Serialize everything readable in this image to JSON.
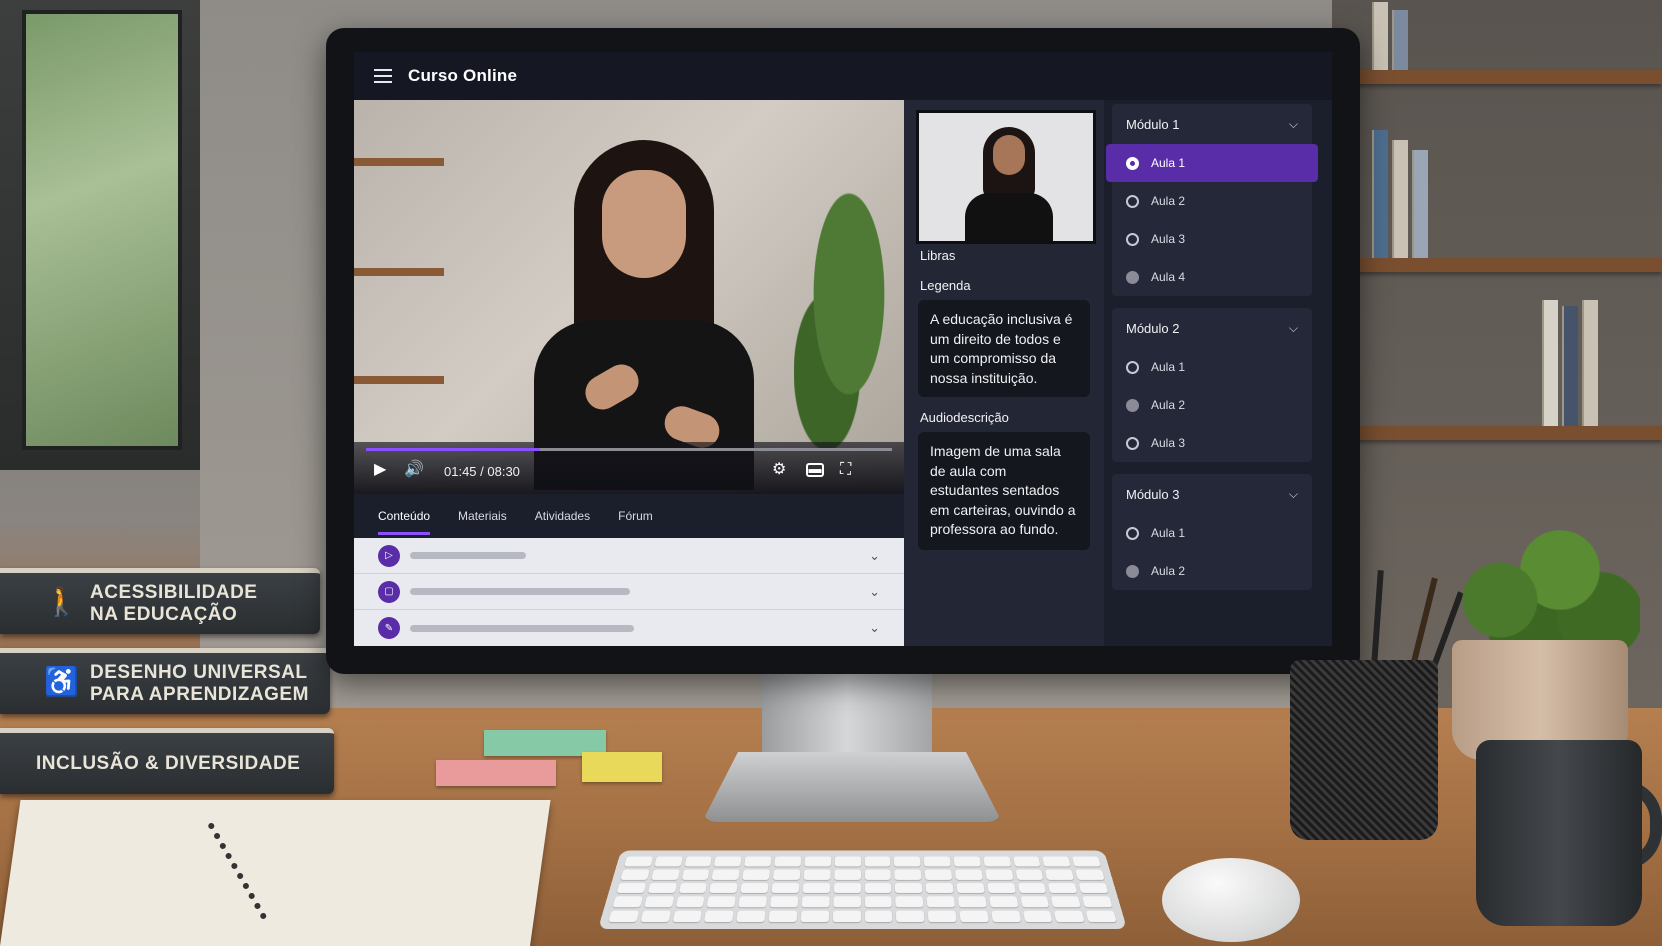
{
  "app": {
    "title": "Curso Online"
  },
  "player": {
    "time": "01:45 / 08:30",
    "progress": 0.33,
    "icons": [
      "play-icon",
      "volume-icon",
      "settings-icon",
      "captions-icon",
      "fullscreen-icon"
    ]
  },
  "tabs": [
    {
      "label": "Conteúdo",
      "active": true
    },
    {
      "label": "Materiais",
      "active": false
    },
    {
      "label": "Atividades",
      "active": false
    },
    {
      "label": "Fórum",
      "active": false
    }
  ],
  "content_rows": [
    {
      "icon": "video-icon"
    },
    {
      "icon": "document-icon"
    },
    {
      "icon": "activity-icon"
    }
  ],
  "accessibility": {
    "libras_label": "Libras",
    "legenda_label": "Legenda",
    "legenda_text": "A educação inclusiva é um direito de todos e um compromisso da nossa instituição.",
    "audiodesc_label": "Audiodescrição",
    "audiodesc_text": "Imagem de uma sala de aula com estudantes sentados em carteiras, ouvindo a professora ao fundo."
  },
  "modules": [
    {
      "title": "Módulo 1",
      "lessons": [
        {
          "label": "Aula 1",
          "state": "selected"
        },
        {
          "label": "Aula 2",
          "state": "empty"
        },
        {
          "label": "Aula 3",
          "state": "empty"
        },
        {
          "label": "Aula 4",
          "state": "filled"
        }
      ]
    },
    {
      "title": "Módulo 2",
      "lessons": [
        {
          "label": "Aula 1",
          "state": "empty"
        },
        {
          "label": "Aula 2",
          "state": "filled"
        },
        {
          "label": "Aula 3",
          "state": "empty"
        }
      ]
    },
    {
      "title": "Módulo 3",
      "lessons": [
        {
          "label": "Aula 1",
          "state": "empty"
        },
        {
          "label": "Aula 2",
          "state": "filled"
        }
      ]
    }
  ],
  "books": [
    {
      "title_line1": "Acessibilidade",
      "title_line2": "na Educação",
      "icon": "person-icon"
    },
    {
      "title_line1": "Desenho Universal",
      "title_line2": "para Aprendizagem",
      "icon": "wheelchair-icon"
    },
    {
      "title_line1": "Inclusão & Diversidade",
      "title_line2": "",
      "icon": ""
    }
  ],
  "colors": {
    "accent": "#5a2da8",
    "progress": "#8a4fff",
    "panel": "#1b1e2b"
  }
}
